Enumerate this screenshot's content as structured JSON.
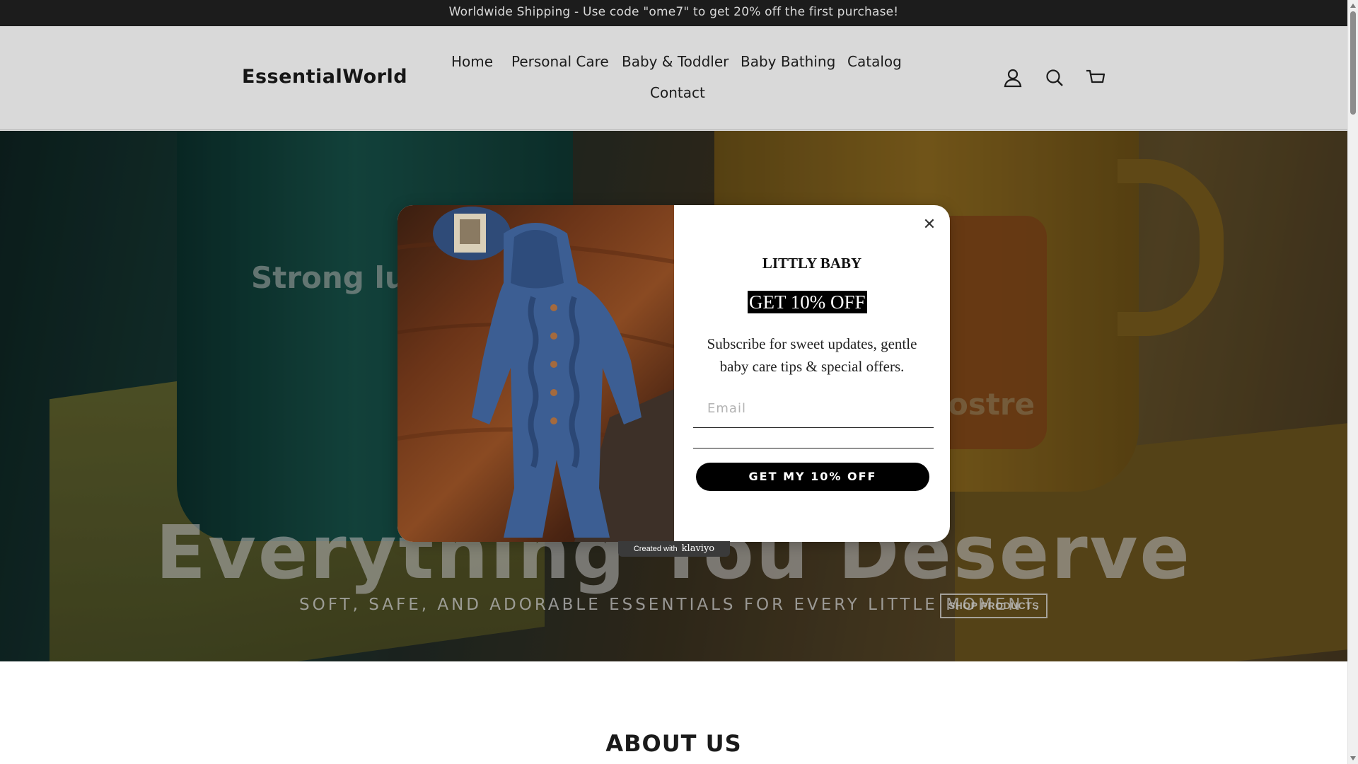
{
  "announcement": {
    "text": "Worldwide Shipping - Use code \"ome7\" to get 20% off the first purchase!"
  },
  "header": {
    "logo": "EssentialWorld",
    "nav": [
      "Home",
      "Personal Care",
      "Baby & Toddler",
      "Baby Bathing",
      "Catalog",
      "Contact"
    ],
    "icons": [
      "account-icon",
      "search-icon",
      "cart-icon"
    ]
  },
  "hero": {
    "cup_text_left": "Strong lus",
    "cup_text_right": "ostre",
    "title": "Everything You Deserve",
    "subtitle": "SOFT, SAFE, AND ADORABLE ESSENTIALS FOR EVERY LITTLE MOMENT.",
    "cta": "SHOP PRODUCTS"
  },
  "popup": {
    "brand": "LITTLY BABY",
    "offer": "GET 10% OFF",
    "description": "Subscribe for sweet updates, gentle baby care tips & special offers.",
    "email_placeholder": "Email",
    "submit_label": "GET MY 10% OFF",
    "close_icon": "close-icon",
    "badge_prefix": "Created with",
    "badge_brand": "klaviyo"
  },
  "about": {
    "title": "ABOUT US"
  },
  "colors": {
    "announcement_bg": "#1c1c1c",
    "button": "#000000",
    "accent_offer_bg": "#000000"
  }
}
